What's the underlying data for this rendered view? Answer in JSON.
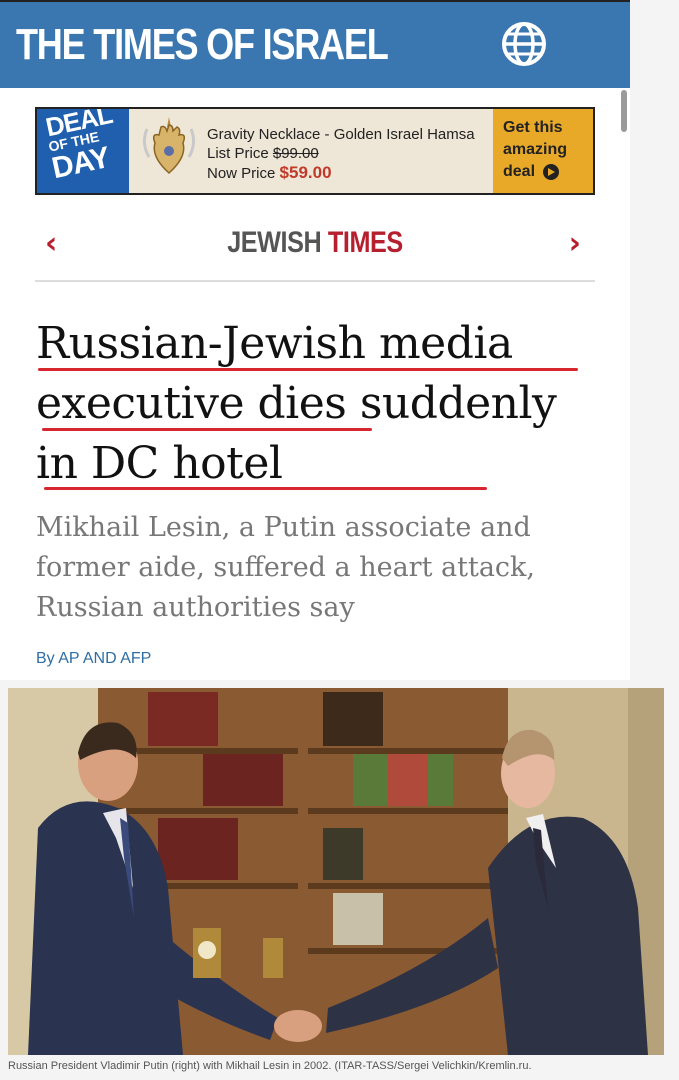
{
  "header": {
    "logo_text": "THE TIMES OF ISRAEL",
    "globe_icon": "globe-icon",
    "brand_color": "#3a77b0"
  },
  "ad": {
    "badge_line1": "DEAL",
    "badge_line2": "OF THE",
    "badge_line3": "DAY",
    "product_name": "Gravity Necklace - Golden Israel Hamsa",
    "list_price_label": "List Price",
    "list_price": "$99.00",
    "new_price_label": "Now Price",
    "new_price": "$59.00",
    "cta": "Get this amazing deal"
  },
  "section": {
    "title_part1": "JEWISH",
    "title_part2": "TIMES",
    "accent_color": "#b51f2e"
  },
  "article": {
    "headline": "Russian-Jewish media executive dies suddenly in DC hotel",
    "subheadline": "Mikhail Lesin, a Putin associate and former aide, suffered a heart attack, Russian authorities say",
    "byline": "By AP AND AFP"
  },
  "photo": {
    "caption": "Russian President Vladimir Putin (right) with Mikhail Lesin in 2002. (ITAR-TASS/Sergei Velichkin/Kremlin.ru."
  }
}
